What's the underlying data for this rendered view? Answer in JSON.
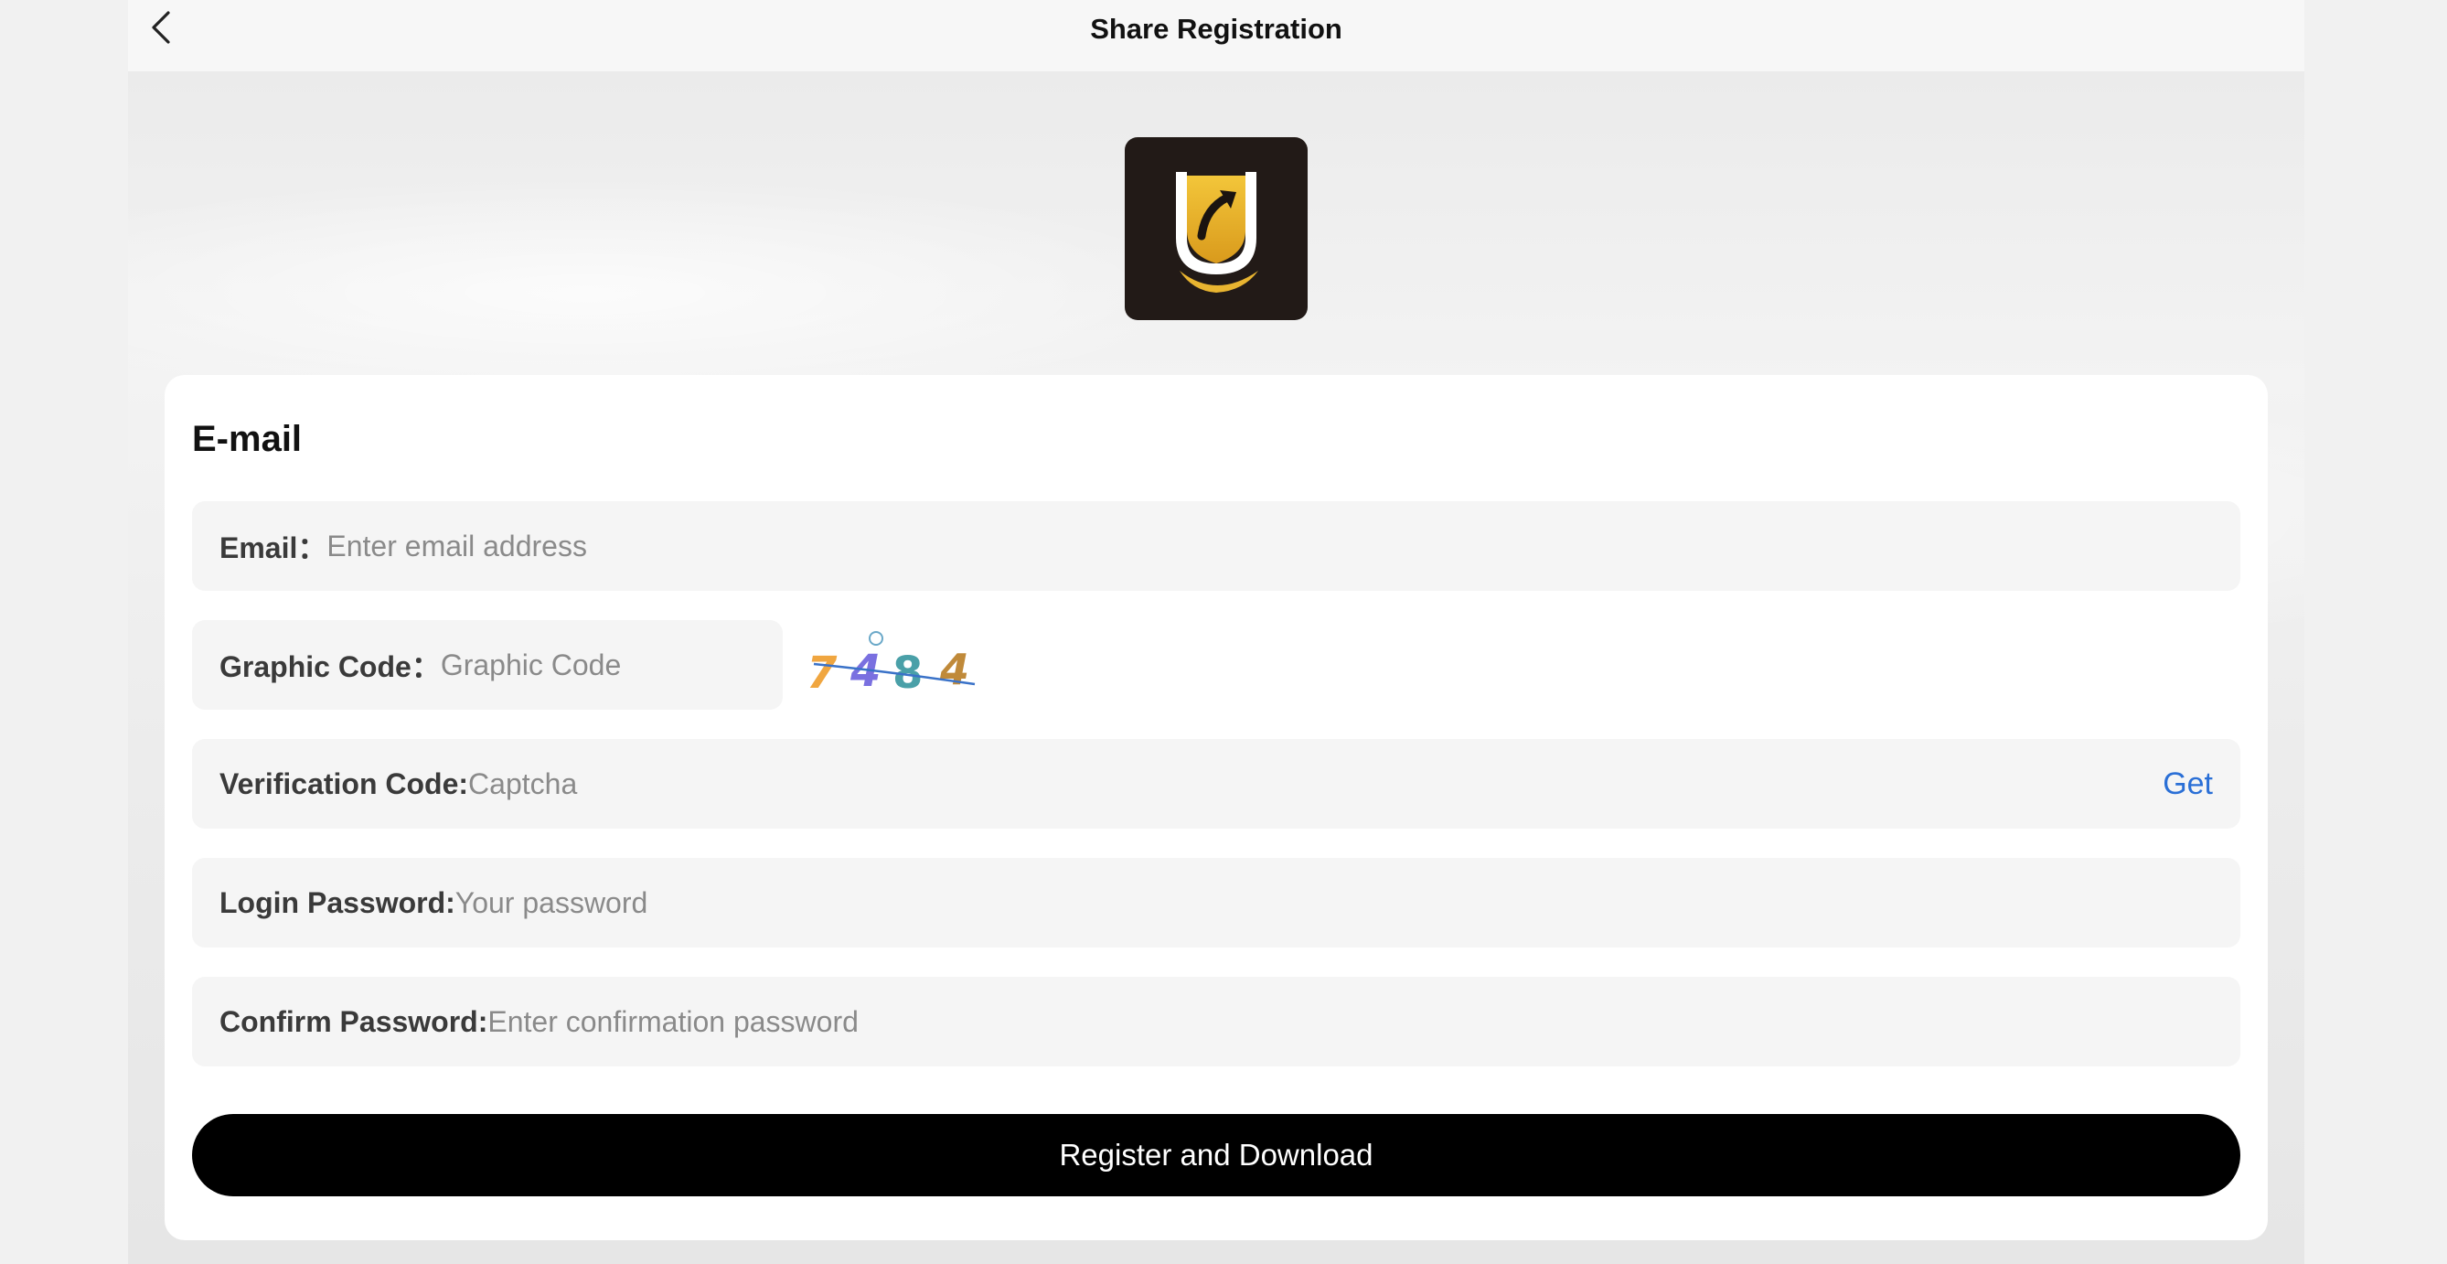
{
  "nav": {
    "title": "Share Registration",
    "back_icon": "chevron-left-icon"
  },
  "logo": {
    "icon": "app-logo-u-shield",
    "colors": {
      "background": "#221a17",
      "gold": "#e8b430",
      "white": "#ffffff"
    }
  },
  "form": {
    "section_title": "E-mail",
    "email": {
      "label": "Email：",
      "placeholder": "Enter email address"
    },
    "graphic_code": {
      "label": "Graphic Code：",
      "placeholder": "Graphic Code",
      "captcha_chars": [
        "7",
        "4",
        "8",
        "4"
      ]
    },
    "verification_code": {
      "label": "Verification Code:",
      "placeholder": "Captcha",
      "get_label": "Get"
    },
    "login_password": {
      "label": "Login Password:",
      "placeholder": "Your password"
    },
    "confirm_password": {
      "label": "Confirm Password:",
      "placeholder": "Enter confirmation password"
    },
    "submit_label": "Register and Download"
  },
  "colors": {
    "accent_link": "#2a6fd6",
    "button": "#000000",
    "field_bg": "#f5f5f5"
  }
}
